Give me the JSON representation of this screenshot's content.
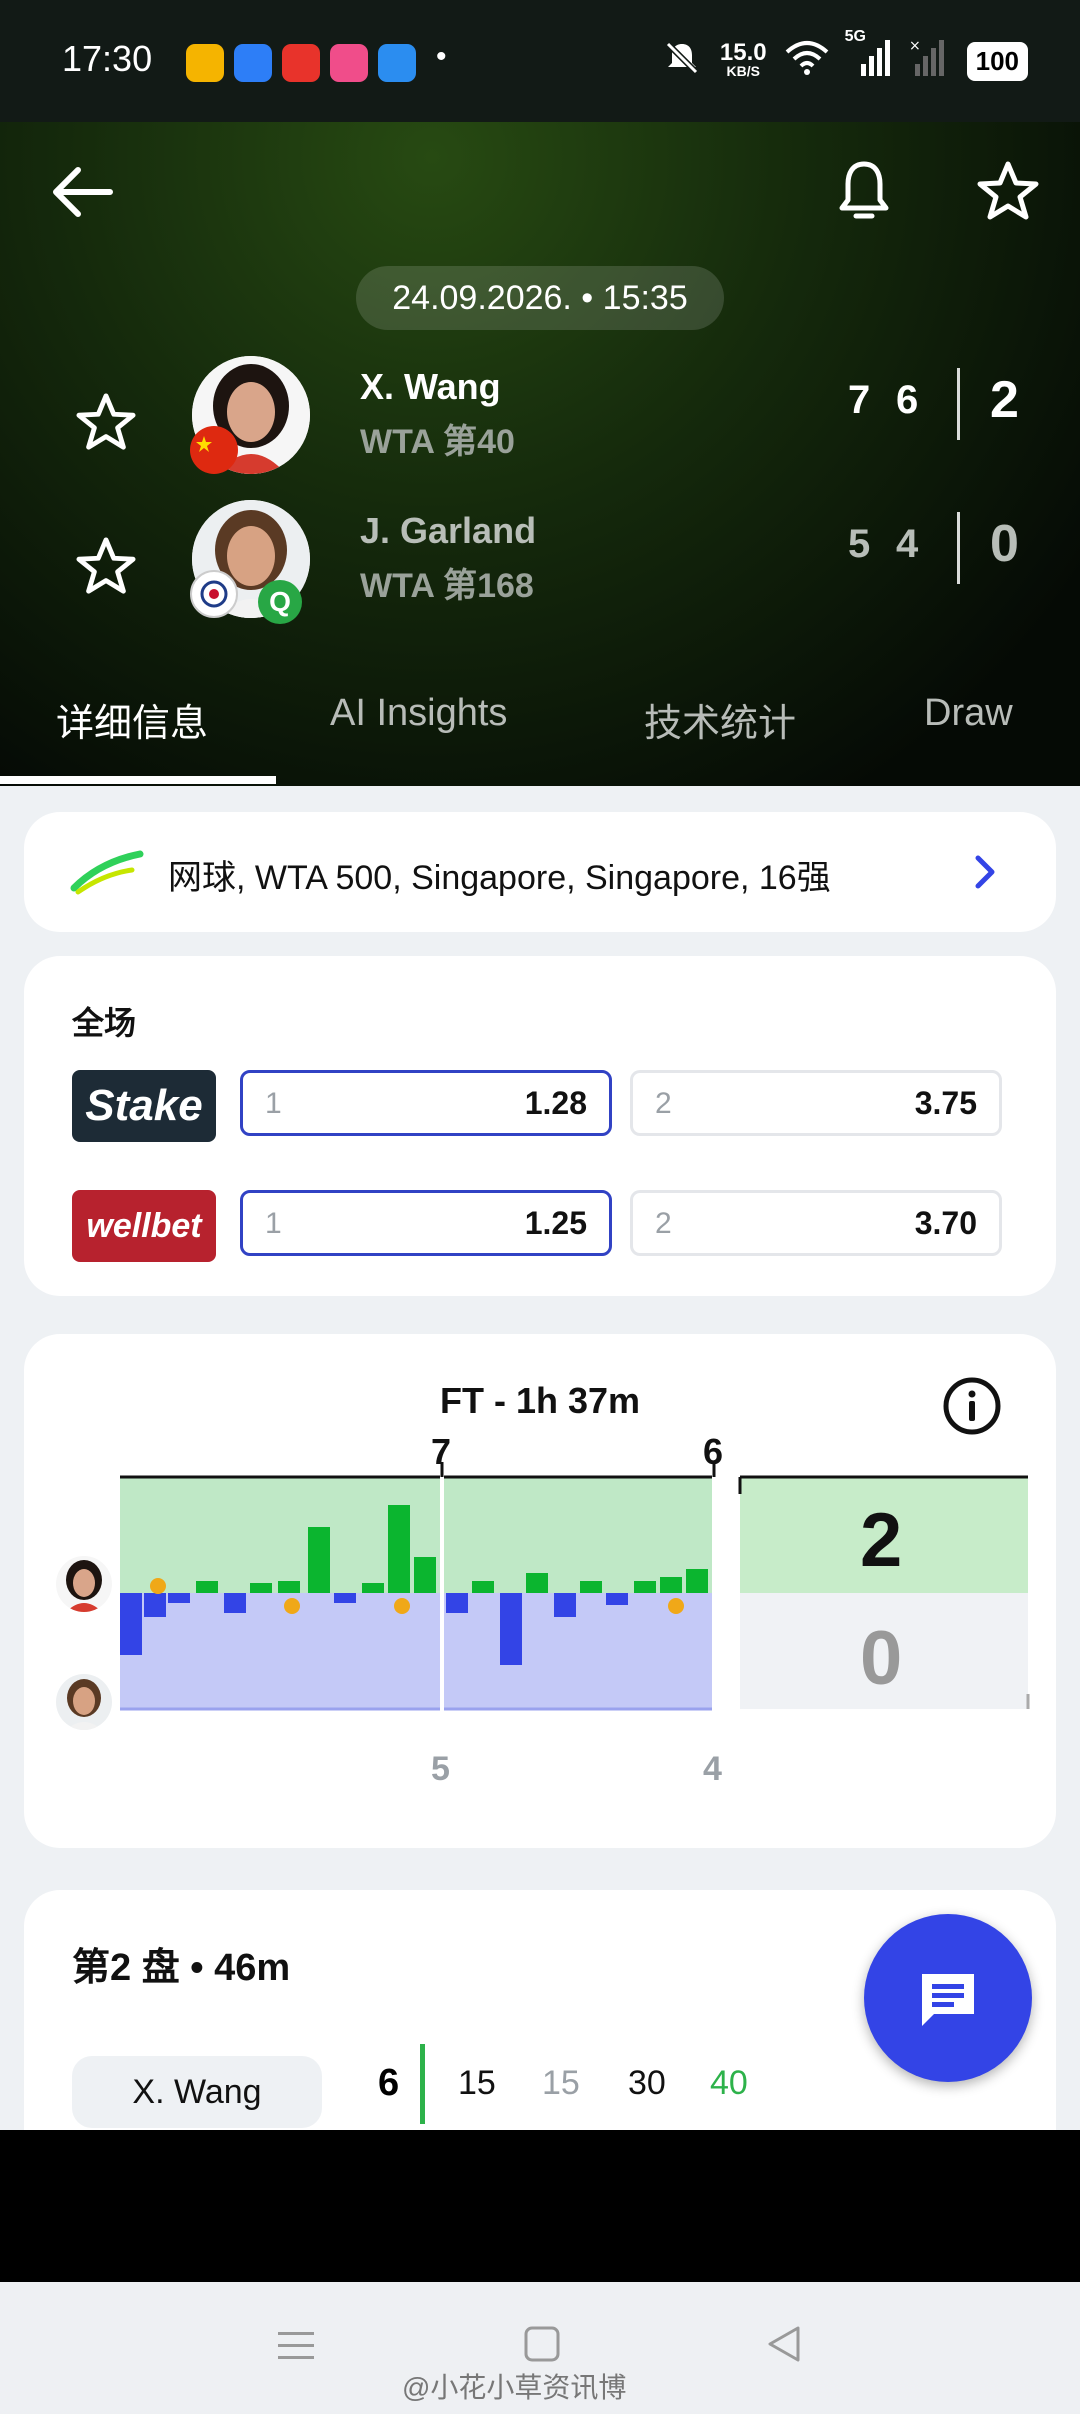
{
  "status_bar": {
    "time": "17:30",
    "net_speed": "15.0",
    "net_unit": "KB/S",
    "signal": "5G",
    "battery": "100"
  },
  "header": {
    "date": "24.09.2026. • 15:35",
    "players": [
      {
        "name": "X. Wang",
        "rank": "WTA 第40",
        "sets": [
          "7",
          "6"
        ],
        "total": "2"
      },
      {
        "name": "J. Garland",
        "rank": "WTA 第168",
        "qualifier_badge": "Q",
        "sets": [
          "5",
          "4"
        ],
        "total": "0"
      }
    ]
  },
  "tabs": [
    "详细信息",
    "AI Insights",
    "技术统计",
    "Draw"
  ],
  "tournament": {
    "text": "网球, WTA 500, Singapore, Singapore, 16强"
  },
  "odds": {
    "title": "全场",
    "rows": [
      {
        "book": "Stake",
        "book_color": "#1d2b36",
        "o1_label": "1",
        "o1": "1.28",
        "o2_label": "2",
        "o2": "3.75"
      },
      {
        "book": "wellbet",
        "book_color": "#b7222e",
        "o1_label": "1",
        "o1": "1.25",
        "o2_label": "2",
        "o2": "3.70"
      }
    ]
  },
  "momentum": {
    "title": "FT - 1h 37m",
    "set_top": [
      "7",
      "6"
    ],
    "set_bottom": [
      "5",
      "4"
    ],
    "final_top": "2",
    "final_bottom": "0",
    "colors": {
      "player1": "#0bb52f",
      "player2": "#3344e6"
    }
  },
  "set2": {
    "title": "第2 盘 • 46m",
    "player": "X. Wang",
    "score": "6",
    "points": [
      "15",
      "15",
      "30",
      "40"
    ]
  },
  "watermark": "@小花小草资讯博"
}
